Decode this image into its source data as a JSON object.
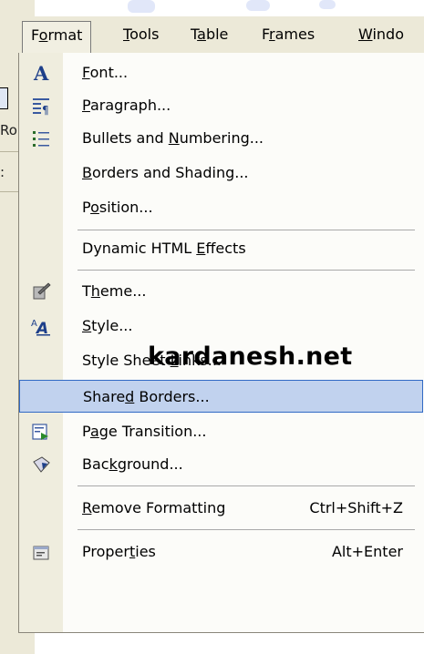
{
  "left_fragments": {
    "ro": "Ro",
    "colon": ":"
  },
  "menubar": [
    {
      "label_pre": "F",
      "label_u": "o",
      "label_post": "rmat",
      "active": true
    },
    {
      "label_pre": "",
      "label_u": "T",
      "label_post": "ools",
      "active": false
    },
    {
      "label_pre": "T",
      "label_u": "a",
      "label_post": "ble",
      "active": false
    },
    {
      "label_pre": "F",
      "label_u": "r",
      "label_post": "ames",
      "active": false
    },
    {
      "label_pre": "",
      "label_u": "W",
      "label_post": "indo",
      "active": false
    }
  ],
  "menu_items": [
    {
      "pre": "",
      "u": "F",
      "post": "ont...",
      "shortcut": "",
      "icon": "font-icon"
    },
    {
      "pre": "",
      "u": "P",
      "post": "aragraph...",
      "shortcut": "",
      "icon": "paragraph-icon"
    },
    {
      "pre": "Bullets and ",
      "u": "N",
      "post": "umbering...",
      "shortcut": "",
      "icon": "bullets-icon"
    },
    {
      "pre": "",
      "u": "B",
      "post": "orders and Shading...",
      "shortcut": "",
      "icon": ""
    },
    {
      "pre": "P",
      "u": "o",
      "post": "sition...",
      "shortcut": "",
      "icon": ""
    },
    {
      "pre": "Dynamic HTML ",
      "u": "E",
      "post": "ffects",
      "shortcut": "",
      "icon": ""
    },
    {
      "pre": "T",
      "u": "h",
      "post": "eme...",
      "shortcut": "",
      "icon": "theme-icon"
    },
    {
      "pre": "",
      "u": "S",
      "post": "tyle...",
      "shortcut": "",
      "icon": "style-icon"
    },
    {
      "pre": "Style Sheet ",
      "u": "L",
      "post": "inks...",
      "shortcut": "",
      "icon": ""
    },
    {
      "pre": "Share",
      "u": "d",
      "post": " Borders...",
      "shortcut": "",
      "icon": "",
      "selected": true
    },
    {
      "pre": "P",
      "u": "a",
      "post": "ge Transition...",
      "shortcut": "",
      "icon": "page-transition-icon"
    },
    {
      "pre": "Bac",
      "u": "k",
      "post": "ground...",
      "shortcut": "",
      "icon": "background-icon"
    },
    {
      "pre": "",
      "u": "R",
      "post": "emove Formatting",
      "shortcut": "Ctrl+Shift+Z",
      "icon": ""
    },
    {
      "pre": "Proper",
      "u": "t",
      "post": "ies",
      "shortcut": "Alt+Enter",
      "icon": "properties-icon"
    }
  ],
  "watermark": "kardanesh.net"
}
